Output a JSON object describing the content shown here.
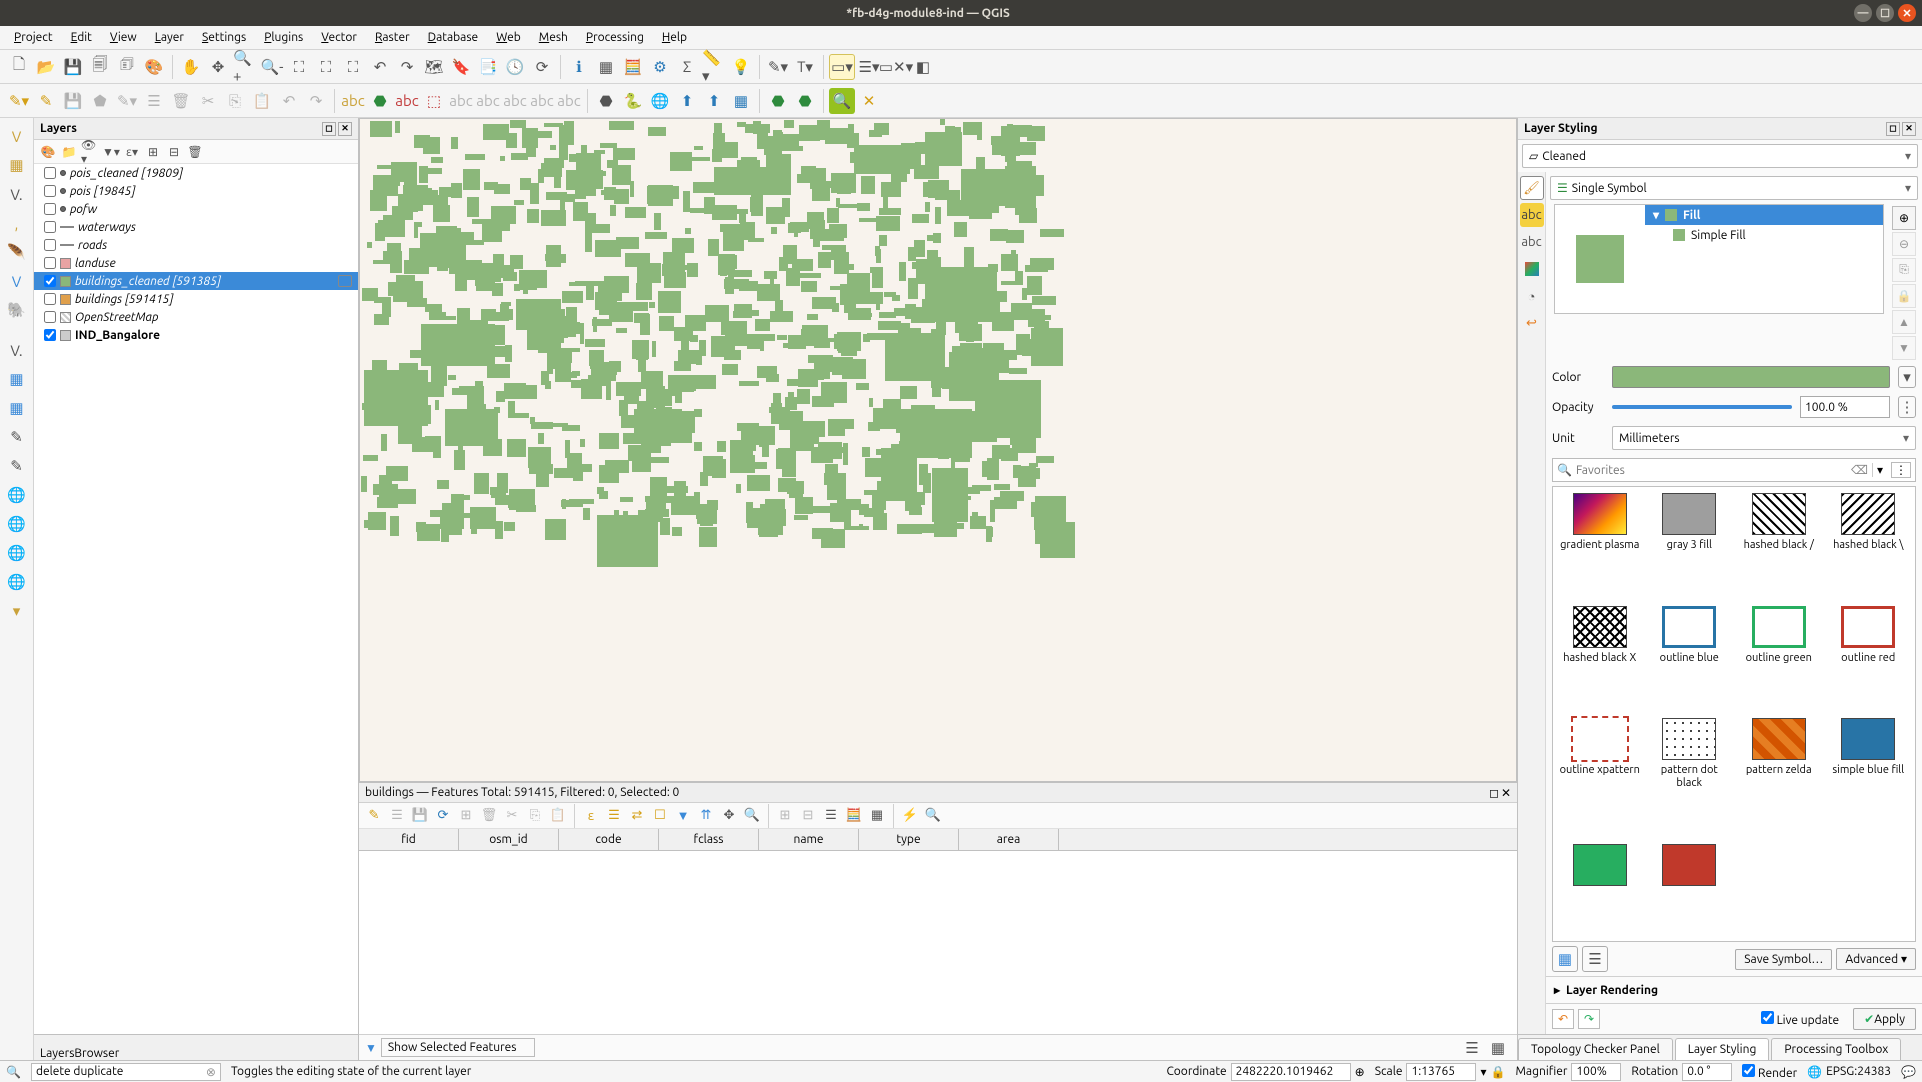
{
  "titlebar": {
    "title": "*fb-d4g-module8-ind — QGIS"
  },
  "menu": [
    "Project",
    "Edit",
    "View",
    "Layer",
    "Settings",
    "Plugins",
    "Vector",
    "Raster",
    "Database",
    "Web",
    "Mesh",
    "Processing",
    "Help"
  ],
  "layers_panel": {
    "title": "Layers",
    "items": [
      {
        "name": "pois_cleaned [19809]",
        "type": "point",
        "checked": false
      },
      {
        "name": "pois [19845]",
        "type": "point",
        "checked": false
      },
      {
        "name": "pofw",
        "type": "point",
        "checked": false
      },
      {
        "name": "waterways",
        "type": "line",
        "checked": false
      },
      {
        "name": "roads",
        "type": "line",
        "checked": false
      },
      {
        "name": "landuse",
        "type": "poly",
        "checked": false,
        "color": "#e8a3a3"
      },
      {
        "name": "buildings_cleaned [591385]",
        "type": "poly",
        "checked": true,
        "color": "#8bb77a",
        "selected": true,
        "indicator": true
      },
      {
        "name": "buildings [591415]",
        "type": "poly",
        "checked": false,
        "color": "#e0a04c"
      },
      {
        "name": "OpenStreetMap",
        "type": "raster",
        "checked": false
      },
      {
        "name": "IND_Bangalore",
        "type": "poly",
        "checked": true,
        "bold": true
      }
    ],
    "bottom_tabs": [
      "Layers",
      "Browser"
    ]
  },
  "attribute_table": {
    "title": "buildings — Features Total: 591415, Filtered: 0, Selected: 0",
    "columns": [
      "fid",
      "osm_id",
      "code",
      "fclass",
      "name",
      "type",
      "area"
    ],
    "footer_filter": "Show Selected Features"
  },
  "layer_styling": {
    "title": "Layer Styling",
    "layer_combo": "Cleaned",
    "renderer": "Single Symbol",
    "symbol_layers": [
      {
        "label": "Fill",
        "selected": true
      },
      {
        "label": "Simple Fill",
        "selected": false
      }
    ],
    "color_label": "Color",
    "opacity_label": "Opacity",
    "opacity_value": "100.0 %",
    "unit_label": "Unit",
    "unit_value": "Millimeters",
    "search_placeholder": "Favorites",
    "styles": [
      {
        "name": "gradient plasma",
        "thumb": "gradient"
      },
      {
        "name": "gray 3 fill",
        "thumb": "gray"
      },
      {
        "name": "hashed black /",
        "thumb": "hash1"
      },
      {
        "name": "hashed black \\",
        "thumb": "hash2"
      },
      {
        "name": "hashed black X",
        "thumb": "hashx"
      },
      {
        "name": "outline blue",
        "thumb": "oblue"
      },
      {
        "name": "outline green",
        "thumb": "ogreen"
      },
      {
        "name": "outline red",
        "thumb": "ored"
      },
      {
        "name": "outline xpattern",
        "thumb": "oxpat"
      },
      {
        "name": "pattern dot black",
        "thumb": "pdot"
      },
      {
        "name": "pattern zelda",
        "thumb": "pzelda"
      },
      {
        "name": "simple blue fill",
        "thumb": "sblue"
      },
      {
        "name": "",
        "thumb": "sgreen"
      },
      {
        "name": "",
        "thumb": "sred"
      }
    ],
    "save_symbol": "Save Symbol…",
    "advanced": "Advanced",
    "layer_rendering": "Layer Rendering",
    "live_update": "Live update",
    "apply": "Apply",
    "bottom_tabs": [
      "Topology Checker Panel",
      "Layer Styling",
      "Processing Toolbox"
    ]
  },
  "statusbar": {
    "locator_value": "delete duplicate",
    "hint": "Toggles the editing state of the current layer",
    "coord_label": "Coordinate",
    "coord_value": "2482220.1019462",
    "scale_label": "Scale",
    "scale_value": "1:13765",
    "magnifier_label": "Magnifier",
    "magnifier_value": "100%",
    "rotation_label": "Rotation",
    "rotation_value": "0.0 °",
    "render": "Render",
    "crs": "EPSG:24383"
  }
}
